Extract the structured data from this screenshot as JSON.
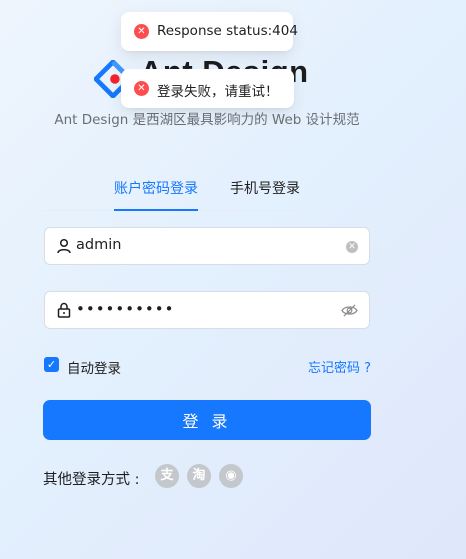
{
  "brand": {
    "title": "Ant Design",
    "subtitle": "Ant Design 是西湖区最具影响力的 Web 设计规范"
  },
  "tabs": [
    {
      "label": "账户密码登录",
      "active": true
    },
    {
      "label": "手机号登录",
      "active": false
    }
  ],
  "form": {
    "username_value": "admin",
    "password_value": "••••••••••",
    "remember_label": "自动登录",
    "remember_checked": true,
    "forgot_label": "忘记密码 ?",
    "submit_label": "登 录"
  },
  "other_login": {
    "label": "其他登录方式 :",
    "icons": [
      "alipay-icon",
      "taobao-icon",
      "weibo-icon"
    ]
  },
  "toasts": [
    {
      "type": "error",
      "message": "Response status:404"
    },
    {
      "type": "error",
      "message": "登录失败，请重试！"
    }
  ],
  "colors": {
    "primary": "#1677ff",
    "error": "#ff4d4f",
    "social_icon": "#c4c7cc"
  }
}
